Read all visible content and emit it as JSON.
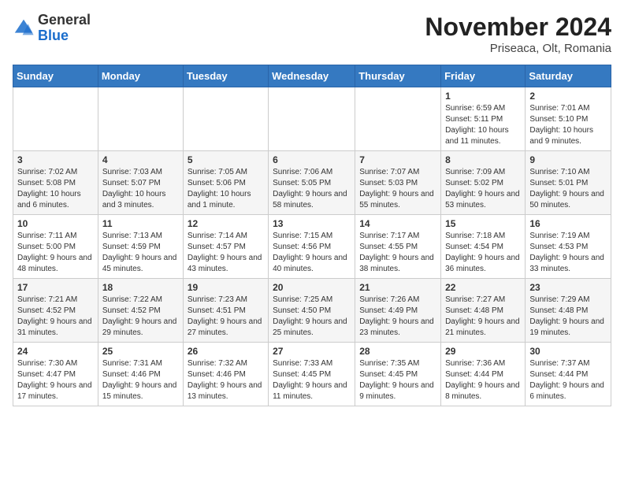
{
  "header": {
    "logo": {
      "general": "General",
      "blue": "Blue"
    },
    "title": "November 2024",
    "location": "Priseaca, Olt, Romania"
  },
  "weekdays": [
    "Sunday",
    "Monday",
    "Tuesday",
    "Wednesday",
    "Thursday",
    "Friday",
    "Saturday"
  ],
  "weeks": [
    [
      {
        "day": "",
        "info": ""
      },
      {
        "day": "",
        "info": ""
      },
      {
        "day": "",
        "info": ""
      },
      {
        "day": "",
        "info": ""
      },
      {
        "day": "",
        "info": ""
      },
      {
        "day": "1",
        "info": "Sunrise: 6:59 AM\nSunset: 5:11 PM\nDaylight: 10 hours and 11 minutes."
      },
      {
        "day": "2",
        "info": "Sunrise: 7:01 AM\nSunset: 5:10 PM\nDaylight: 10 hours and 9 minutes."
      }
    ],
    [
      {
        "day": "3",
        "info": "Sunrise: 7:02 AM\nSunset: 5:08 PM\nDaylight: 10 hours and 6 minutes."
      },
      {
        "day": "4",
        "info": "Sunrise: 7:03 AM\nSunset: 5:07 PM\nDaylight: 10 hours and 3 minutes."
      },
      {
        "day": "5",
        "info": "Sunrise: 7:05 AM\nSunset: 5:06 PM\nDaylight: 10 hours and 1 minute."
      },
      {
        "day": "6",
        "info": "Sunrise: 7:06 AM\nSunset: 5:05 PM\nDaylight: 9 hours and 58 minutes."
      },
      {
        "day": "7",
        "info": "Sunrise: 7:07 AM\nSunset: 5:03 PM\nDaylight: 9 hours and 55 minutes."
      },
      {
        "day": "8",
        "info": "Sunrise: 7:09 AM\nSunset: 5:02 PM\nDaylight: 9 hours and 53 minutes."
      },
      {
        "day": "9",
        "info": "Sunrise: 7:10 AM\nSunset: 5:01 PM\nDaylight: 9 hours and 50 minutes."
      }
    ],
    [
      {
        "day": "10",
        "info": "Sunrise: 7:11 AM\nSunset: 5:00 PM\nDaylight: 9 hours and 48 minutes."
      },
      {
        "day": "11",
        "info": "Sunrise: 7:13 AM\nSunset: 4:59 PM\nDaylight: 9 hours and 45 minutes."
      },
      {
        "day": "12",
        "info": "Sunrise: 7:14 AM\nSunset: 4:57 PM\nDaylight: 9 hours and 43 minutes."
      },
      {
        "day": "13",
        "info": "Sunrise: 7:15 AM\nSunset: 4:56 PM\nDaylight: 9 hours and 40 minutes."
      },
      {
        "day": "14",
        "info": "Sunrise: 7:17 AM\nSunset: 4:55 PM\nDaylight: 9 hours and 38 minutes."
      },
      {
        "day": "15",
        "info": "Sunrise: 7:18 AM\nSunset: 4:54 PM\nDaylight: 9 hours and 36 minutes."
      },
      {
        "day": "16",
        "info": "Sunrise: 7:19 AM\nSunset: 4:53 PM\nDaylight: 9 hours and 33 minutes."
      }
    ],
    [
      {
        "day": "17",
        "info": "Sunrise: 7:21 AM\nSunset: 4:52 PM\nDaylight: 9 hours and 31 minutes."
      },
      {
        "day": "18",
        "info": "Sunrise: 7:22 AM\nSunset: 4:52 PM\nDaylight: 9 hours and 29 minutes."
      },
      {
        "day": "19",
        "info": "Sunrise: 7:23 AM\nSunset: 4:51 PM\nDaylight: 9 hours and 27 minutes."
      },
      {
        "day": "20",
        "info": "Sunrise: 7:25 AM\nSunset: 4:50 PM\nDaylight: 9 hours and 25 minutes."
      },
      {
        "day": "21",
        "info": "Sunrise: 7:26 AM\nSunset: 4:49 PM\nDaylight: 9 hours and 23 minutes."
      },
      {
        "day": "22",
        "info": "Sunrise: 7:27 AM\nSunset: 4:48 PM\nDaylight: 9 hours and 21 minutes."
      },
      {
        "day": "23",
        "info": "Sunrise: 7:29 AM\nSunset: 4:48 PM\nDaylight: 9 hours and 19 minutes."
      }
    ],
    [
      {
        "day": "24",
        "info": "Sunrise: 7:30 AM\nSunset: 4:47 PM\nDaylight: 9 hours and 17 minutes."
      },
      {
        "day": "25",
        "info": "Sunrise: 7:31 AM\nSunset: 4:46 PM\nDaylight: 9 hours and 15 minutes."
      },
      {
        "day": "26",
        "info": "Sunrise: 7:32 AM\nSunset: 4:46 PM\nDaylight: 9 hours and 13 minutes."
      },
      {
        "day": "27",
        "info": "Sunrise: 7:33 AM\nSunset: 4:45 PM\nDaylight: 9 hours and 11 minutes."
      },
      {
        "day": "28",
        "info": "Sunrise: 7:35 AM\nSunset: 4:45 PM\nDaylight: 9 hours and 9 minutes."
      },
      {
        "day": "29",
        "info": "Sunrise: 7:36 AM\nSunset: 4:44 PM\nDaylight: 9 hours and 8 minutes."
      },
      {
        "day": "30",
        "info": "Sunrise: 7:37 AM\nSunset: 4:44 PM\nDaylight: 9 hours and 6 minutes."
      }
    ]
  ]
}
